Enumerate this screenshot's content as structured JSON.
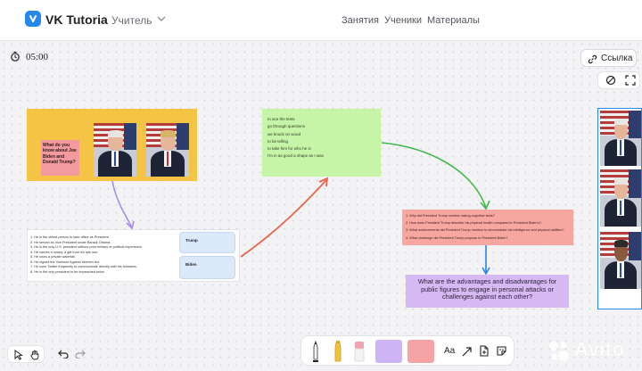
{
  "header": {
    "app_title": "VK Tutoria",
    "role": "Учитель",
    "nav": [
      "Занятия",
      "Ученики",
      "Материалы"
    ]
  },
  "timer": {
    "value": "05:00"
  },
  "share": {
    "label": "Ссылка"
  },
  "board": {
    "question_sticky": "What do you know about Joe Biden and Donald Trump?",
    "phrases": [
      "to ace the tests",
      "go through questions",
      "we knock on wood",
      "to be telling",
      "to take him for who he is",
      "I'm in as good a shape as I was"
    ],
    "facts": [
      "1. He is the oldest person to take office as President.",
      "2. He served as Vice President under Barack Obama.",
      "3. He is the only U.S. president without prior military or political experience.",
      "4. He carries a rosary, a gift from his late son.",
      "5. He owns a private waterfall.",
      "6. He signed the Violence Against Women Act.",
      "7. He uses Twitter frequently to communicate directly with his followers.",
      "8. He is the only president to be impeached twice."
    ],
    "trump_label": "Trump",
    "biden_label": "Biden",
    "questions": [
      "1. Why did President Trump mention taking cognitive tests?",
      "2. How does President Trump describe his physical health compared to President Biden's?",
      "3. What achievements did President Trump mention to demonstrate his intelligence and physical abilities?",
      "4. What challenge did President Trump propose to President Biden?"
    ],
    "discussion": "What are the advantages and disadvantages for public figures to engage in personal attacks or challenges against each other?"
  },
  "toolbar": {
    "text_tool": "Aa"
  },
  "watermark": "Avito",
  "colors": {
    "accent": "#2688eb",
    "yellow": "#f6c445",
    "green": "#c7f5a7",
    "pink": "#f8a6a0",
    "purple": "#d6b8f2",
    "sticky_pink": "#f29a9d"
  }
}
